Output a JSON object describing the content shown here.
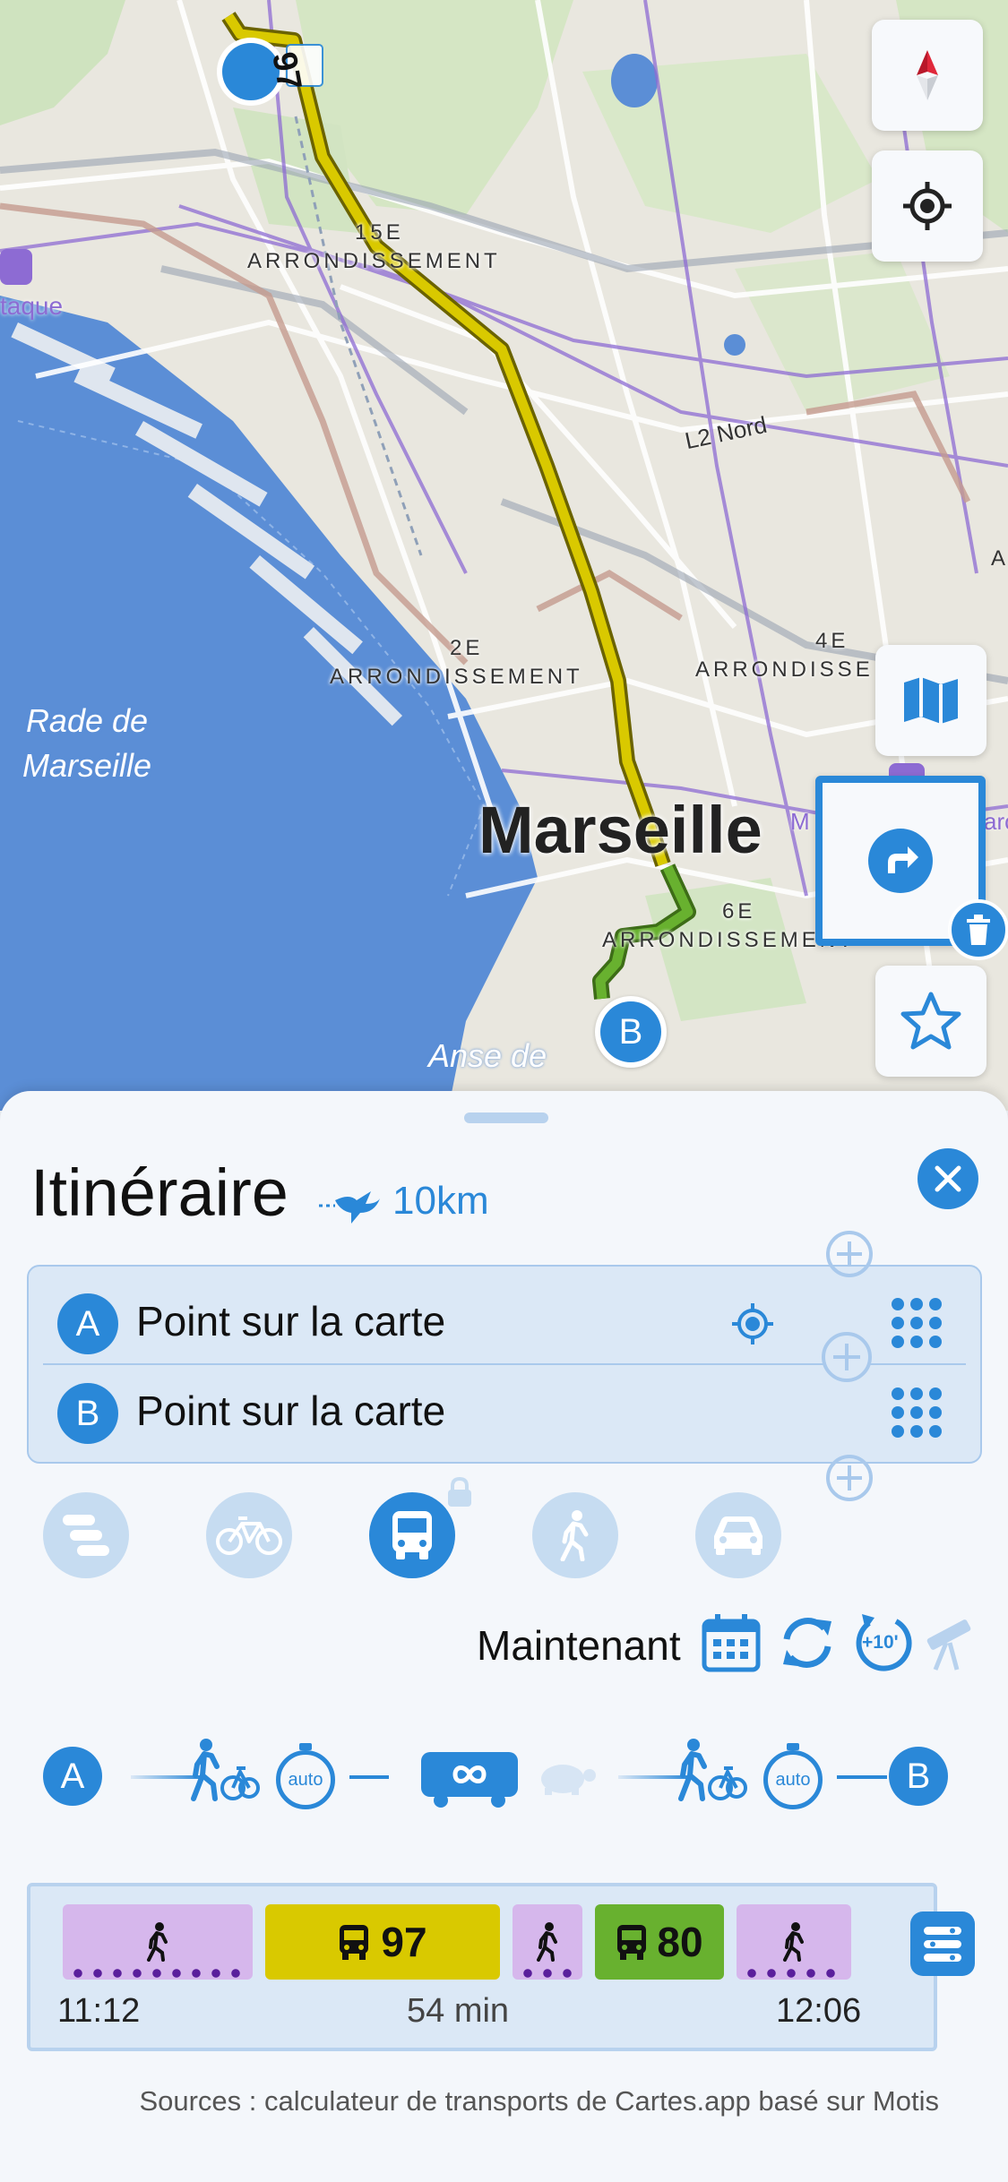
{
  "map": {
    "labels": {
      "arr15": "15E",
      "arr15_word": "ARRONDISSEMENT",
      "arr2": "2E",
      "arr2_word": "ARRONDISSEMENT",
      "arr4": "4E",
      "arr4_word": "ARRONDISSE",
      "arr6": "6E",
      "arr6_word": "ARRONDISSEMENT",
      "l2nord": "L2 Nord",
      "estaque": "taque",
      "rade_line1": "Rade de",
      "rade_line2": "Marseille",
      "city": "Marseille",
      "anse": "Anse de",
      "right_a": "A",
      "right_m": "M",
      "right_arc": "arc",
      "route_label": "97",
      "end_marker": "B"
    },
    "colors": {
      "sea": "#5b8ed6",
      "land": "#e8e6de",
      "route_bus97": "#d9c900",
      "route_bus80": "#68b12f",
      "accent": "#2a88d8"
    },
    "controls": [
      "compass-icon",
      "locate-icon",
      "map-layers-icon",
      "directions-icon",
      "trash-icon",
      "star-icon"
    ]
  },
  "sheet": {
    "title": "Itinéraire",
    "distance": "10km",
    "points": [
      {
        "marker": "A",
        "label": "Point sur la carte"
      },
      {
        "marker": "B",
        "label": "Point sur la carte"
      }
    ],
    "modes": [
      {
        "icon": "filter-list-icon",
        "active": false
      },
      {
        "icon": "bicycle-icon",
        "active": false
      },
      {
        "icon": "bus-icon",
        "active": true
      },
      {
        "icon": "walk-icon",
        "active": false
      },
      {
        "icon": "car-icon",
        "active": false
      }
    ],
    "time_label": "Maintenant",
    "plus10": "+10'",
    "chain": {
      "start": "A",
      "end": "B",
      "auto_left": "auto",
      "auto_right": "auto"
    },
    "journey": {
      "segments": [
        {
          "type": "walk",
          "label": ""
        },
        {
          "type": "bus",
          "label": "97",
          "color": "#d9c900"
        },
        {
          "type": "walk",
          "label": ""
        },
        {
          "type": "bus",
          "label": "80",
          "color": "#68b12f"
        },
        {
          "type": "walk",
          "label": ""
        }
      ],
      "depart": "11:12",
      "duration": "54 min",
      "arrive": "12:06"
    },
    "sources": "Sources : calculateur de transports de Cartes.app basé sur Motis"
  }
}
